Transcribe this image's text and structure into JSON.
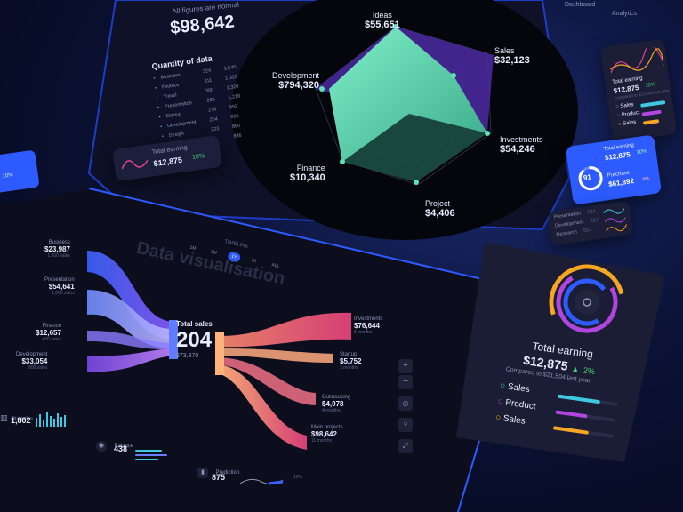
{
  "summary": {
    "note": "All figures are normal",
    "total": "$98,642",
    "quantity_title": "Quantity of data",
    "rows": [
      {
        "name": "Business",
        "a": "324",
        "b": "1,540"
      },
      {
        "name": "Finance",
        "a": "311",
        "b": "1,320"
      },
      {
        "name": "Travel",
        "a": "300",
        "b": "1,320"
      },
      {
        "name": "Presentation",
        "a": "289",
        "b": "1,219"
      },
      {
        "name": "Startup",
        "a": "276",
        "b": "993"
      },
      {
        "name": "Development",
        "a": "254",
        "b": "896"
      },
      {
        "name": "Design",
        "a": "223",
        "b": "880"
      },
      {
        "name": "",
        "a": "",
        "b": "886"
      }
    ],
    "earning_label": "Total earning",
    "earning_value": "$12,875",
    "earning_pct": "10%"
  },
  "nav": {
    "tab1": "Dashboard",
    "tab2": "Analytics"
  },
  "radar": {
    "axes": [
      {
        "name": "Ideas",
        "value": "$55,651"
      },
      {
        "name": "Sales",
        "value": "$32,123"
      },
      {
        "name": "Investments",
        "value": "$54,246"
      },
      {
        "name": "Project",
        "value": "$4,406"
      },
      {
        "name": "Finance",
        "value": "$10,340"
      },
      {
        "name": "Development",
        "value": "$794,320"
      }
    ]
  },
  "right_cards": {
    "card1": {
      "title": "Total earning",
      "value": "$12,875",
      "pct": "10%",
      "sub": "Compared to $21,504 last year",
      "items": [
        "Sales",
        "Product",
        "Sales"
      ]
    },
    "card2": {
      "title": "Total earning",
      "value": "$12,875",
      "pct": "10%",
      "ring": "91",
      "purchase": "Purchase",
      "purchase_value": "$61,892",
      "purchase_pct": "4%"
    },
    "card3": {
      "rows": [
        {
          "name": "Presentation",
          "v": "524"
        },
        {
          "name": "Development",
          "v": "224"
        },
        {
          "name": "Research",
          "v": "553"
        }
      ]
    }
  },
  "blue_tab": {
    "pct": "10%"
  },
  "sankey": {
    "heading": "Data visualisation",
    "filters": [
      "1M",
      "3M",
      "1Y",
      "5Y",
      "ALL"
    ],
    "timeline": "TIMELINE",
    "center_label": "Total sales",
    "center_value": "204",
    "center_sub": "$73,870",
    "left": [
      {
        "name": "Business",
        "value": "$23,987",
        "sub": "1,500 sales"
      },
      {
        "name": "Presentation",
        "value": "$54,641",
        "sub": "1,000 sales"
      },
      {
        "name": "Finance",
        "value": "$12,657",
        "sub": "400 sales"
      },
      {
        "name": "Development",
        "value": "$33,054",
        "sub": "800 sales"
      }
    ],
    "right": [
      {
        "name": "Investments",
        "value": "$76,644",
        "sub": "5 months"
      },
      {
        "name": "Startup",
        "value": "$5,752",
        "sub": "3 months"
      },
      {
        "name": "Outsourcing",
        "value": "$4,978",
        "sub": "4 months"
      },
      {
        "name": "Main projects",
        "value": "$98,642",
        "sub": "11 months"
      }
    ]
  },
  "bottom": {
    "stats_label": "Statistics",
    "stats_value": "1,802",
    "balance_label": "Balance",
    "balance_value": "438",
    "prediction_label": "Prediction",
    "prediction_value": "875",
    "pred_pct": "10%"
  },
  "big_card": {
    "title": "Total earning",
    "value": "$12,875",
    "pct": "2%",
    "sub": "Compared to $21,504 last year",
    "legend": [
      "Sales",
      "Product",
      "Sales"
    ]
  },
  "colors": {
    "accent": "#2d5bff",
    "mint": "#5fe0b5",
    "purple": "#7a3bd8",
    "orange": "#f5a623",
    "pink": "#e0428a",
    "cyan": "#3ec9e0"
  }
}
